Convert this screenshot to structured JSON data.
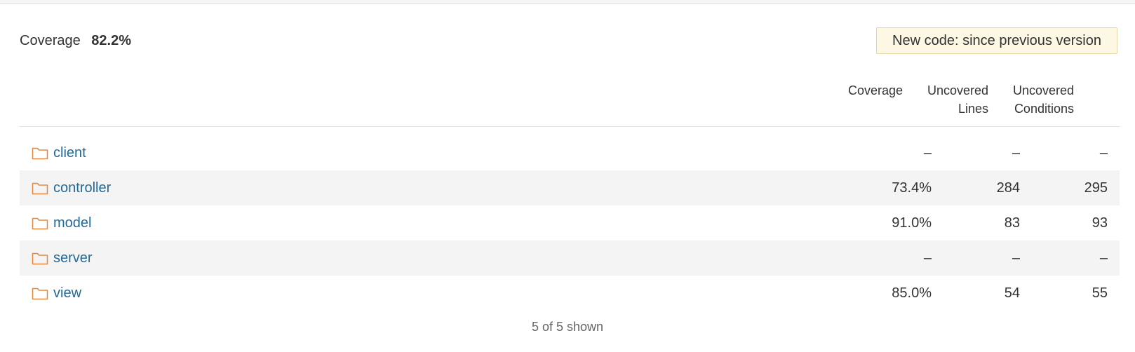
{
  "summary": {
    "label": "Coverage",
    "value": "82.2%"
  },
  "new_code": {
    "label": "New code: since previous version"
  },
  "columns": {
    "coverage": [
      "Coverage"
    ],
    "uncovered_lines": [
      "Uncovered",
      "Lines"
    ],
    "uncovered_conditions": [
      "Uncovered",
      "Conditions"
    ]
  },
  "rows": [
    {
      "name": "client",
      "coverage": "–",
      "uncovered_lines": "–",
      "uncovered_conditions": "–"
    },
    {
      "name": "controller",
      "coverage": "73.4%",
      "uncovered_lines": "284",
      "uncovered_conditions": "295"
    },
    {
      "name": "model",
      "coverage": "91.0%",
      "uncovered_lines": "83",
      "uncovered_conditions": "93"
    },
    {
      "name": "server",
      "coverage": "–",
      "uncovered_lines": "–",
      "uncovered_conditions": "–"
    },
    {
      "name": "view",
      "coverage": "85.0%",
      "uncovered_lines": "54",
      "uncovered_conditions": "55"
    }
  ],
  "footer": {
    "shown_text": "5 of 5 shown"
  },
  "colors": {
    "link": "#236a97",
    "folder_icon": "#e6883c",
    "badge_bg": "#fcf8e3",
    "row_alt": "#f4f4f4"
  },
  "icons": {
    "row_icon": "folder-icon"
  }
}
